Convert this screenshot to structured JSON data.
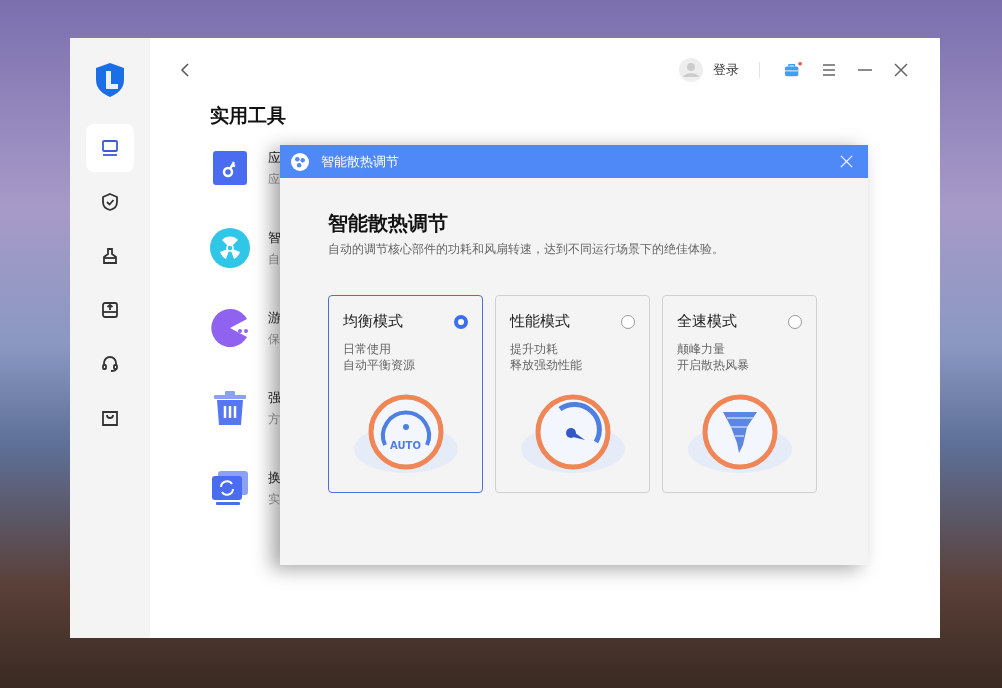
{
  "header": {
    "login": "登录"
  },
  "page": {
    "title": "实用工具"
  },
  "sidebar": {
    "items": [
      {
        "kind": "laptop",
        "selected": true
      },
      {
        "kind": "shield",
        "selected": false
      },
      {
        "kind": "broom",
        "selected": false
      },
      {
        "kind": "drive",
        "selected": false
      },
      {
        "kind": "headset",
        "selected": false
      },
      {
        "kind": "bag",
        "selected": false
      }
    ]
  },
  "tools": [
    {
      "kind": "key",
      "title": "应",
      "desc": "应"
    },
    {
      "kind": "fan",
      "title": "智",
      "desc": "自"
    },
    {
      "kind": "pacman",
      "title": "游",
      "desc": "保"
    },
    {
      "kind": "trash",
      "title": "强",
      "desc": "方"
    },
    {
      "kind": "switch",
      "title": "换",
      "desc": "实"
    }
  ],
  "dialog": {
    "title": "智能散热调节",
    "heading": "智能散热调节",
    "description": "自动的调节核心部件的功耗和风扇转速，达到不同运行场景下的绝佳体验。",
    "modes": [
      {
        "kind": "auto",
        "name": "均衡模式",
        "line1": "日常使用",
        "line2": "自动平衡资源",
        "badge": "AUTO",
        "selected": true
      },
      {
        "kind": "gauge",
        "name": "性能模式",
        "line1": "提升功耗",
        "line2": "释放强劲性能",
        "selected": false
      },
      {
        "kind": "tornado",
        "name": "全速模式",
        "line1": "颠峰力量",
        "line2": "开启散热风暴",
        "selected": false
      }
    ]
  }
}
